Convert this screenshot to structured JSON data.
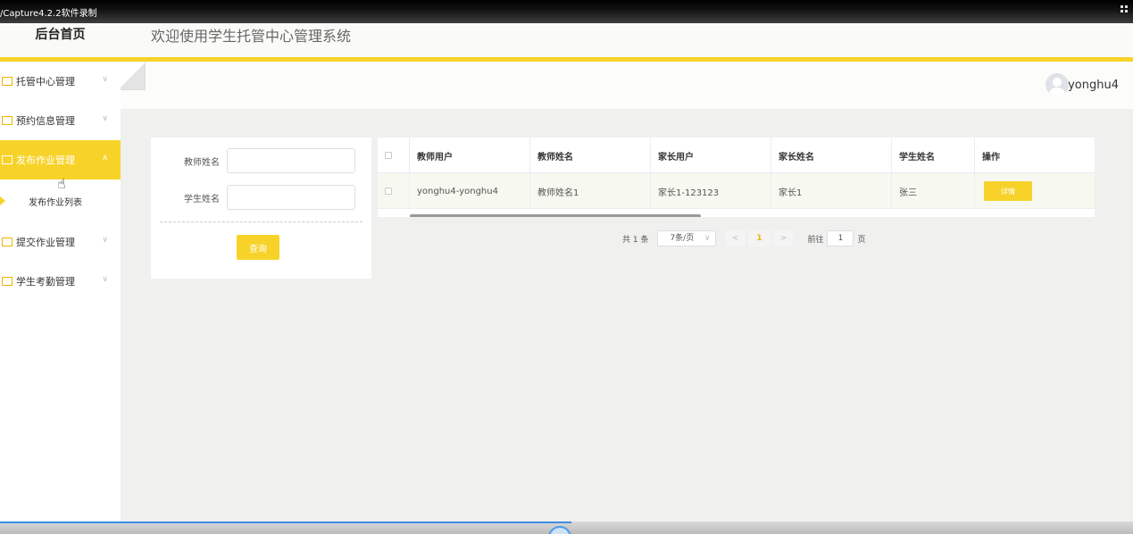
{
  "recorder": {
    "title": "/Capture4.2.2软件录制"
  },
  "header": {
    "brand": "后台首页",
    "system_title": "欢迎使用学生托管中心管理系统",
    "accent_color": "#f7d32a"
  },
  "user": {
    "name": "yonghu4"
  },
  "sidebar": {
    "items": [
      {
        "label": "托管中心管理",
        "expanded": false
      },
      {
        "label": "预约信息管理",
        "expanded": false
      },
      {
        "label": "发布作业管理",
        "expanded": true,
        "active": true
      },
      {
        "label": "提交作业管理",
        "expanded": false
      },
      {
        "label": "学生考勤管理",
        "expanded": false
      }
    ],
    "sub_item": "发布作业列表"
  },
  "search": {
    "teacher_name_label": "教师姓名",
    "teacher_name_value": "",
    "student_name_label": "学生姓名",
    "student_name_value": "",
    "query_button": "查询"
  },
  "table": {
    "columns": [
      "教师用户",
      "教师姓名",
      "家长用户",
      "家长姓名",
      "学生姓名",
      "操作"
    ],
    "rows": [
      {
        "teacher_user": "yonghu4-yonghu4",
        "teacher_name": "教师姓名1",
        "parent_user": "家长1-123123",
        "parent_name": "家长1",
        "student_name": "张三",
        "action": "详情"
      }
    ]
  },
  "pagination": {
    "total": "共 1 条",
    "page_size": "7条/页",
    "prev": "<",
    "current": "1",
    "next": ">",
    "goto_label": "前往",
    "goto_value": "1",
    "unit": "页"
  }
}
